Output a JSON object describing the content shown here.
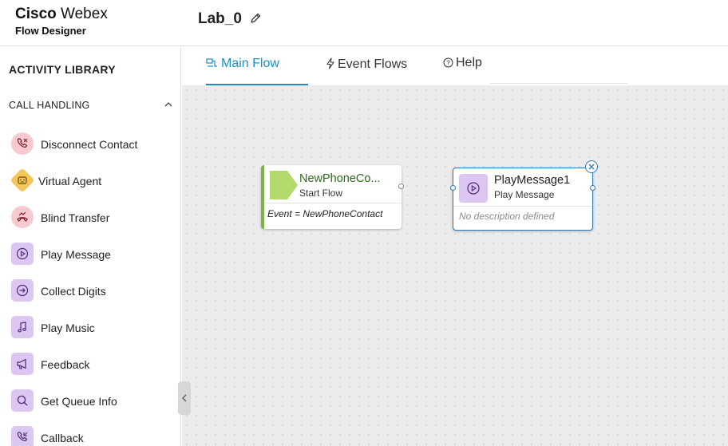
{
  "header": {
    "brand_line1_bold": "Cisco",
    "brand_line1_rest": " Webex",
    "brand_line2": "Flow Designer",
    "flow_title": "Lab_0"
  },
  "sidebar": {
    "title": "ACTIVITY LIBRARY",
    "section": "CALL HANDLING",
    "items": [
      {
        "label": "Disconnect Contact",
        "icon": "disconnect-phone-icon"
      },
      {
        "label": "Virtual Agent",
        "icon": "robot-icon"
      },
      {
        "label": "Blind Transfer",
        "icon": "transfer-phone-icon"
      },
      {
        "label": "Play Message",
        "icon": "play-icon"
      },
      {
        "label": "Collect Digits",
        "icon": "arrow-circle-icon"
      },
      {
        "label": "Play Music",
        "icon": "music-note-icon"
      },
      {
        "label": "Feedback",
        "icon": "megaphone-icon"
      },
      {
        "label": "Get Queue Info",
        "icon": "search-icon"
      },
      {
        "label": "Callback",
        "icon": "callback-phone-icon"
      }
    ]
  },
  "tabs": [
    {
      "label": "Main Flow",
      "active": true,
      "icon": "flow-icon"
    },
    {
      "label": "Event Flows",
      "active": false,
      "icon": "lightning-icon"
    },
    {
      "label": "Help",
      "active": false,
      "icon": "help-icon"
    }
  ],
  "canvas": {
    "start_node": {
      "title": "NewPhoneCo...",
      "subtitle": "Start Flow",
      "event": "Event = NewPhoneContact"
    },
    "play_node": {
      "title": "PlayMessage1",
      "subtitle": "Play Message",
      "description": "No description defined"
    }
  },
  "colors": {
    "accent": "#1a8fc8",
    "start_green": "#7cb342",
    "start_title": "#2f6b1c",
    "node_border": "#2b7cb8",
    "canvas_bg": "#ececec"
  }
}
